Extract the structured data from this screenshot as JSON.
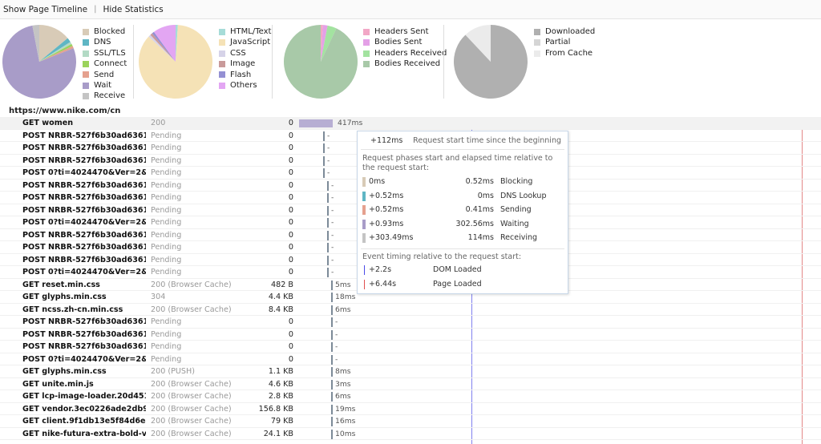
{
  "toolbar": {
    "show_timeline": "Show Page Timeline",
    "separator": "|",
    "hide_statistics": "Hide Statistics"
  },
  "pies": [
    {
      "name": "timings",
      "slices": [
        {
          "label": "Blocked",
          "value": 14,
          "color": "#d8cbb7"
        },
        {
          "label": "DNS",
          "value": 2,
          "color": "#5fb6c4"
        },
        {
          "label": "SSL/TLS",
          "value": 1,
          "color": "#b3dac5"
        },
        {
          "label": "Connect",
          "value": 1,
          "color": "#9bd35c"
        },
        {
          "label": "Send",
          "value": 1,
          "color": "#e5a18f"
        },
        {
          "label": "Wait",
          "value": 78,
          "color": "#a89cc8"
        },
        {
          "label": "Receive",
          "value": 3,
          "color": "#c4c4c4"
        }
      ]
    },
    {
      "name": "content-types",
      "slices": [
        {
          "label": "HTML/Text",
          "value": 1,
          "color": "#a6dcd8"
        },
        {
          "label": "JavaScript",
          "value": 86,
          "color": "#f5e2b6"
        },
        {
          "label": "CSS",
          "value": 1,
          "color": "#d6d3e8"
        },
        {
          "label": "Image",
          "value": 1,
          "color": "#c99a9a"
        },
        {
          "label": "Flash",
          "value": 1,
          "color": "#9490d3"
        },
        {
          "label": "Others",
          "value": 10,
          "color": "#e3a6f3"
        }
      ]
    },
    {
      "name": "headers-bodies",
      "slices": [
        {
          "label": "Headers Sent",
          "value": 1,
          "color": "#f2a7c6"
        },
        {
          "label": "Bodies Sent",
          "value": 2,
          "color": "#e4a0e7"
        },
        {
          "label": "Headers Received",
          "value": 4,
          "color": "#a3e3a0"
        },
        {
          "label": "Bodies Received",
          "value": 93,
          "color": "#a8c9a8"
        }
      ]
    },
    {
      "name": "cache",
      "slices": [
        {
          "label": "Downloaded",
          "value": 88,
          "color": "#b0b0b0"
        },
        {
          "label": "Partial",
          "value": 0,
          "color": "#d5d5d5"
        },
        {
          "label": "From Cache",
          "value": 12,
          "color": "#ebebeb"
        }
      ]
    }
  ],
  "host": "https://www.nike.com/cn",
  "rows": [
    {
      "name": "GET women",
      "status": "200",
      "size": "0",
      "time": "417ms"
    },
    {
      "name": "POST NRBR-527f6b30ad636151",
      "status": "Pending",
      "size": "0",
      "time": "-"
    },
    {
      "name": "POST NRBR-527f6b30ad636151",
      "status": "Pending",
      "size": "0",
      "time": "-"
    },
    {
      "name": "POST NRBR-527f6b30ad636151",
      "status": "Pending",
      "size": "0",
      "time": "-"
    },
    {
      "name": "POST 0?ti=4024470&Ver=2&mid",
      "status": "Pending",
      "size": "0",
      "time": "-"
    },
    {
      "name": "POST NRBR-527f6b30ad636151",
      "status": "Pending",
      "size": "0",
      "time": "-"
    },
    {
      "name": "POST NRBR-527f6b30ad636151",
      "status": "Pending",
      "size": "0",
      "time": "-"
    },
    {
      "name": "POST NRBR-527f6b30ad636151",
      "status": "Pending",
      "size": "0",
      "time": "-"
    },
    {
      "name": "POST 0?ti=4024470&Ver=2&mid",
      "status": "Pending",
      "size": "0",
      "time": "-"
    },
    {
      "name": "POST NRBR-527f6b30ad636151",
      "status": "Pending",
      "size": "0",
      "time": "-"
    },
    {
      "name": "POST NRBR-527f6b30ad636151",
      "status": "Pending",
      "size": "0",
      "time": "-"
    },
    {
      "name": "POST NRBR-527f6b30ad636151",
      "status": "Pending",
      "size": "0",
      "time": "-"
    },
    {
      "name": "POST 0?ti=4024470&Ver=2&mid",
      "status": "Pending",
      "size": "0",
      "time": "-"
    },
    {
      "name": "GET reset.min.css",
      "status": "200 (Browser Cache)",
      "size": "482 B",
      "time": "5ms"
    },
    {
      "name": "GET glyphs.min.css",
      "status": "304",
      "size": "4.4 KB",
      "time": "18ms"
    },
    {
      "name": "GET ncss.zh-cn.min.css",
      "status": "200 (Browser Cache)",
      "size": "8.4 KB",
      "time": "6ms"
    },
    {
      "name": "POST NRBR-527f6b30ad636151",
      "status": "Pending",
      "size": "0",
      "time": "-"
    },
    {
      "name": "POST NRBR-527f6b30ad636151",
      "status": "Pending",
      "size": "0",
      "time": "-"
    },
    {
      "name": "POST NRBR-527f6b30ad636151",
      "status": "Pending",
      "size": "0",
      "time": "-"
    },
    {
      "name": "POST 0?ti=4024470&Ver=2&mid",
      "status": "Pending",
      "size": "0",
      "time": "-"
    },
    {
      "name": "GET glyphs.min.css",
      "status": "200 (PUSH)",
      "size": "1.1 KB",
      "time": "8ms"
    },
    {
      "name": "GET unite.min.js",
      "status": "200 (Browser Cache)",
      "size": "4.6 KB",
      "time": "3ms"
    },
    {
      "name": "GET lcp-image-loader.20d4519",
      "status": "200 (Browser Cache)",
      "size": "2.8 KB",
      "time": "6ms"
    },
    {
      "name": "GET vendor.3ec0226ade2db9d",
      "status": "200 (Browser Cache)",
      "size": "156.8 KB",
      "time": "19ms"
    },
    {
      "name": "GET client.9f1db13e5f84d6ed",
      "status": "200 (Browser Cache)",
      "size": "79 KB",
      "time": "16ms"
    },
    {
      "name": "GET nike-futura-extra-bold-v2",
      "status": "200 (Browser Cache)",
      "size": "24.1 KB",
      "time": "10ms"
    }
  ],
  "tooltip": {
    "start": "+112ms",
    "start_label": "Request start time since the beginning",
    "phases_header": "Request phases start and elapsed time relative to the request start:",
    "phases": [
      {
        "start": "0ms",
        "elapsed": "0.52ms",
        "name": "Blocking",
        "color": "#d8cbb7"
      },
      {
        "start": "+0.52ms",
        "elapsed": "0ms",
        "name": "DNS Lookup",
        "color": "#5fb6c4"
      },
      {
        "start": "+0.52ms",
        "elapsed": "0.41ms",
        "name": "Sending",
        "color": "#e5a18f"
      },
      {
        "start": "+0.93ms",
        "elapsed": "302.56ms",
        "name": "Waiting",
        "color": "#a89cc8"
      },
      {
        "start": "+303.49ms",
        "elapsed": "114ms",
        "name": "Receiving",
        "color": "#c4c4c4"
      }
    ],
    "events_header": "Event timing relative to the request start:",
    "events": [
      {
        "time": "+2.2s",
        "name": "DOM Loaded",
        "color": "#4a4ae8"
      },
      {
        "time": "+6.44s",
        "name": "Page Loaded",
        "color": "#e05050"
      }
    ]
  }
}
